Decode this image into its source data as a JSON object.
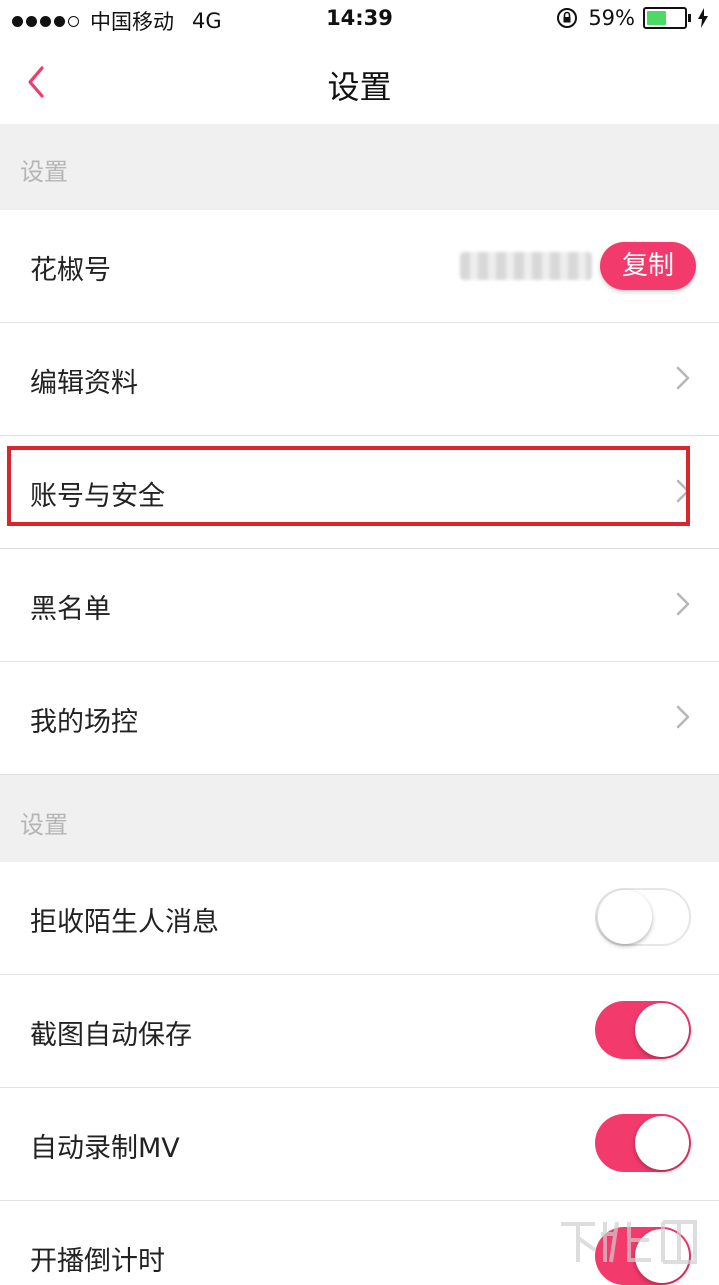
{
  "status_bar": {
    "carrier": "中国移动",
    "network": "4G",
    "time": "14:39",
    "battery": "59%",
    "battery_level": 0.59
  },
  "nav": {
    "title": "设置",
    "back_icon": "chevron-left-icon"
  },
  "sections": [
    {
      "header": "设置"
    },
    {
      "header": "设置"
    }
  ],
  "rows": {
    "huajiao_id": {
      "label": "花椒号",
      "copy_label": "复制"
    },
    "edit_profile": {
      "label": "编辑资料"
    },
    "account_security": {
      "label": "账号与安全"
    },
    "blacklist": {
      "label": "黑名单"
    },
    "my_moderators": {
      "label": "我的场控"
    },
    "reject_strangers": {
      "label": "拒收陌生人消息",
      "toggle": false
    },
    "auto_save_screenshot": {
      "label": "截图自动保存",
      "toggle": true
    },
    "auto_record_mv": {
      "label": "自动录制MV",
      "toggle": true
    },
    "broadcast_countdown": {
      "label": "开播倒计时",
      "toggle": true
    }
  },
  "colors": {
    "accent": "#f23a6c",
    "highlight": "#d9262e",
    "section_bg": "#f0f0f0"
  }
}
